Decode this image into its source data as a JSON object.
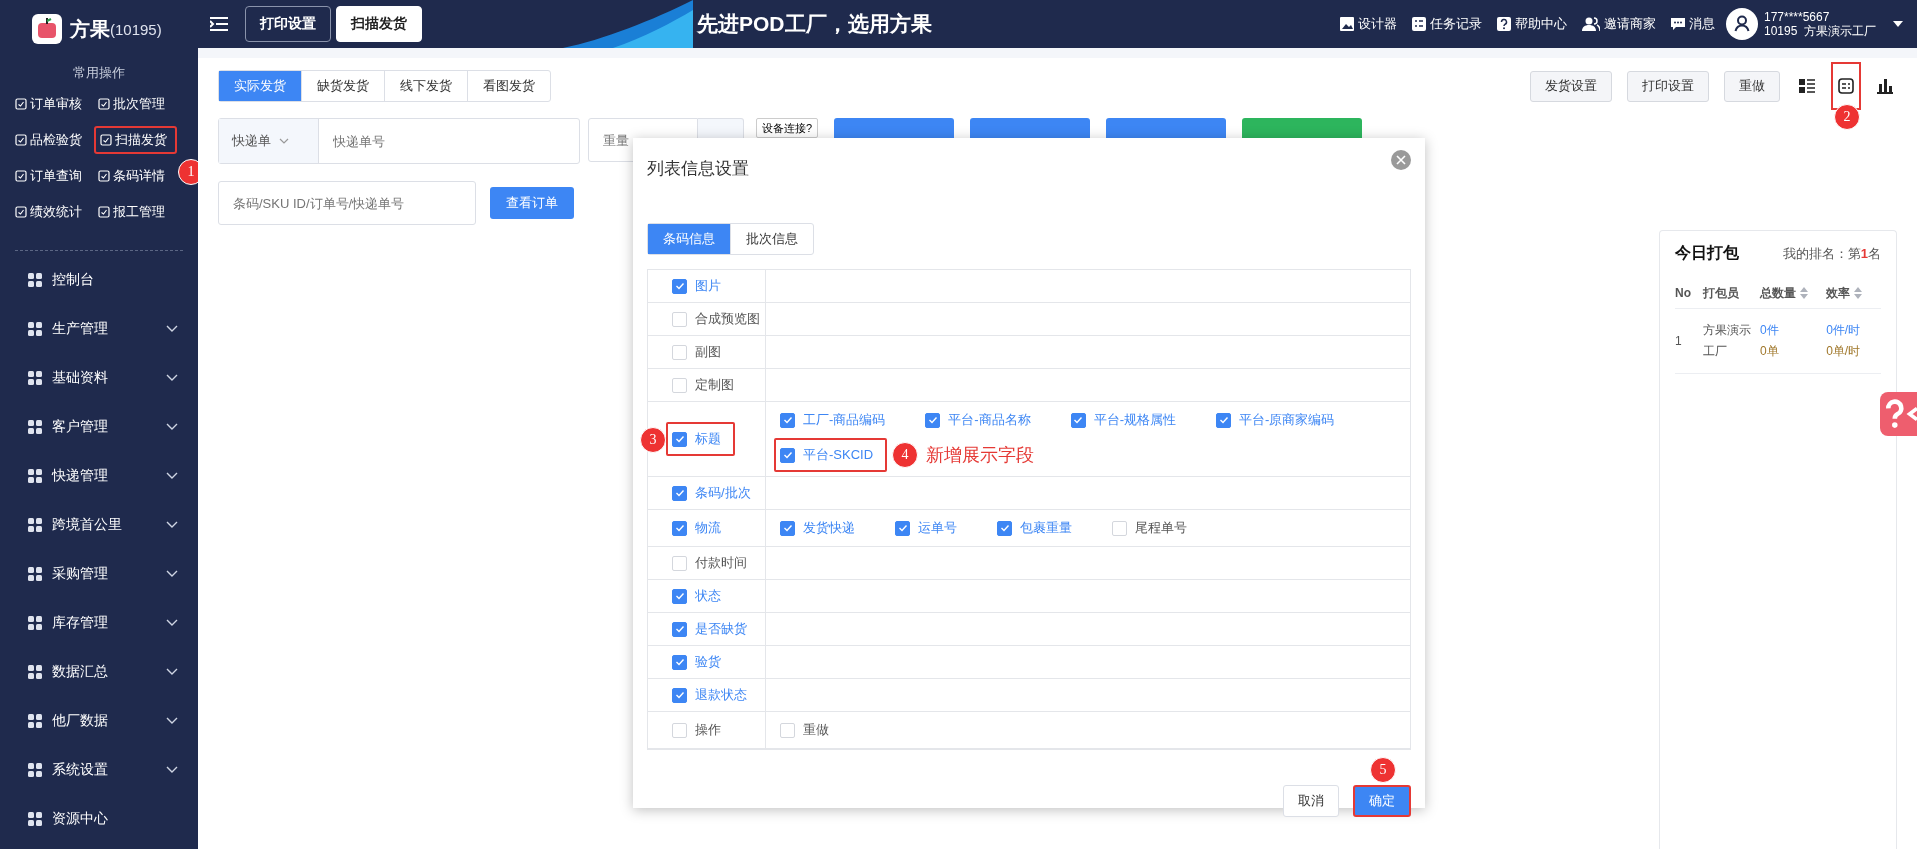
{
  "sidebar": {
    "logo": "方果",
    "account": "(10195)",
    "section_title": "常用操作",
    "quick_actions": [
      {
        "label": "订单审核"
      },
      {
        "label": "批次管理"
      },
      {
        "label": "品检验货"
      },
      {
        "label": "扫描发货",
        "annotation": "1"
      },
      {
        "label": "订单查询"
      },
      {
        "label": "条码详情"
      },
      {
        "label": "绩效统计"
      },
      {
        "label": "报工管理"
      }
    ],
    "nav": [
      {
        "label": "控制台",
        "expandable": false
      },
      {
        "label": "生产管理",
        "expandable": true
      },
      {
        "label": "基础资料",
        "expandable": true
      },
      {
        "label": "客户管理",
        "expandable": true
      },
      {
        "label": "快递管理",
        "expandable": true
      },
      {
        "label": "跨境首公里",
        "expandable": true
      },
      {
        "label": "采购管理",
        "expandable": true
      },
      {
        "label": "库存管理",
        "expandable": true
      },
      {
        "label": "数据汇总",
        "expandable": true
      },
      {
        "label": "他厂数据",
        "expandable": true
      },
      {
        "label": "系统设置",
        "expandable": true
      },
      {
        "label": "资源中心",
        "expandable": false
      }
    ]
  },
  "header": {
    "tabs": [
      {
        "label": "打印设置",
        "selected": false
      },
      {
        "label": "扫描发货",
        "selected": true
      }
    ],
    "slogan": "先进POD工厂，选用方果",
    "links": [
      {
        "label": "设计器"
      },
      {
        "label": "任务记录"
      },
      {
        "label": "帮助中心"
      },
      {
        "label": "邀请商家"
      },
      {
        "label": "消息"
      }
    ],
    "user": {
      "phone": "177****5667",
      "company": "10195  方果演示工厂"
    }
  },
  "toolbar": {
    "tabs": [
      {
        "label": "实际发货",
        "selected": true
      },
      {
        "label": "缺货发货",
        "selected": false
      },
      {
        "label": "线下发货",
        "selected": false
      },
      {
        "label": "看图发货",
        "selected": false
      }
    ],
    "buttons": [
      "发货设置",
      "打印设置",
      "重做"
    ],
    "view_icons": [
      {
        "kind": "list"
      },
      {
        "kind": "form",
        "annotation": "2"
      },
      {
        "kind": "chart"
      }
    ]
  },
  "scan_form": {
    "select": "快递单",
    "tracking_placeholder": "快递单号",
    "weight_placeholder": "重量",
    "device_button": "设备连接?",
    "actions": [
      {
        "color": "#3d86f4"
      },
      {
        "color": "#3d86f4"
      },
      {
        "color": "#3d86f4"
      },
      {
        "color": "#2db55d"
      }
    ],
    "search_placeholder": "条码/SKU ID/订单号/快递单号",
    "search_button": "查看订单"
  },
  "ranking": {
    "title": "今日打包",
    "rank": "我的排名：第**1**名",
    "columns": [
      {
        "label": "No",
        "sortable": false
      },
      {
        "label": "打包员",
        "sortable": false
      },
      {
        "label": "总数量",
        "sortable": true
      },
      {
        "label": "效率",
        "sortable": true
      }
    ],
    "rows": [
      {
        "no": "1",
        "packer": "方果演示工厂",
        "total": [
          "0件",
          "0单"
        ],
        "rate": [
          "0件/时",
          "0单/时"
        ]
      }
    ]
  },
  "modal": {
    "title": "列表信息设置",
    "tabs": [
      {
        "label": "条码信息",
        "selected": true
      },
      {
        "label": "批次信息",
        "selected": false
      }
    ],
    "rows": [
      {
        "label": "图片",
        "checked": true
      },
      {
        "label": "合成预览图",
        "checked": false
      },
      {
        "label": "副图",
        "checked": false
      },
      {
        "label": "定制图",
        "checked": false
      },
      {
        "label": "标题",
        "checked": true,
        "annotation": "3",
        "options": [
          {
            "label": "工厂-商品编码",
            "checked": true
          },
          {
            "label": "平台-商品名称",
            "checked": true
          },
          {
            "label": "平台-规格属性",
            "checked": true
          },
          {
            "label": "平台-原商家编码",
            "checked": true
          },
          {
            "label": "平台-SKCID",
            "checked": true,
            "annotation": "4",
            "note": "新增展示字段"
          }
        ]
      },
      {
        "label": "条码/批次",
        "checked": true
      },
      {
        "label": "物流",
        "checked": true,
        "options": [
          {
            "label": "发货快递",
            "checked": true
          },
          {
            "label": "运单号",
            "checked": true
          },
          {
            "label": "包裹重量",
            "checked": true
          },
          {
            "label": "尾程单号",
            "checked": false
          }
        ]
      },
      {
        "label": "付款时间",
        "checked": false
      },
      {
        "label": "状态",
        "checked": true
      },
      {
        "label": "是否缺货",
        "checked": true
      },
      {
        "label": "验货",
        "checked": true
      },
      {
        "label": "退款状态",
        "checked": true
      },
      {
        "label": "操作",
        "checked": false,
        "options": [
          {
            "label": "重做",
            "checked": false
          }
        ]
      }
    ],
    "cancel": "取消",
    "confirm": "确定",
    "confirm_annotation": "5"
  }
}
